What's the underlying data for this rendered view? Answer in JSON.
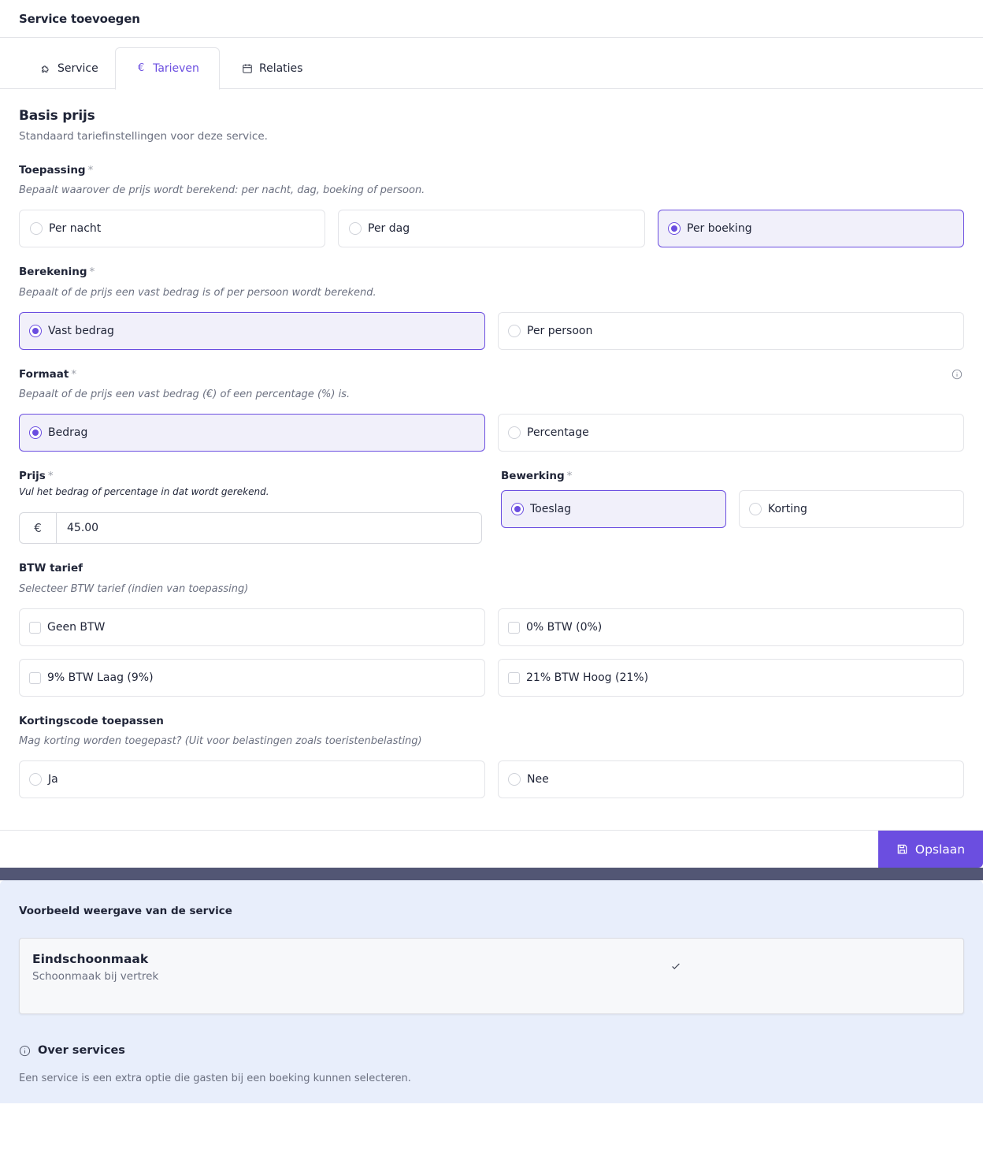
{
  "header": {
    "title": "Service toevoegen"
  },
  "tabs": [
    {
      "label": "Service",
      "icon": "puzzle-icon"
    },
    {
      "label": "Tarieven",
      "icon": "euro-icon"
    },
    {
      "label": "Relaties",
      "icon": "calendar-icon"
    }
  ],
  "active_tab": "Tarieven",
  "basis": {
    "title": "Basis prijs",
    "subtitle": "Standaard tariefinstellingen voor deze service."
  },
  "toepassing": {
    "label": "Toepassing",
    "required": "*",
    "hint": "Bepaalt waarover de prijs wordt berekend: per nacht, dag, boeking of persoon.",
    "options": [
      "Per nacht",
      "Per dag",
      "Per boeking"
    ],
    "selected": "Per boeking"
  },
  "berekening": {
    "label": "Berekening",
    "required": "*",
    "hint": "Bepaalt of de prijs een vast bedrag is of per persoon wordt berekend.",
    "options": [
      "Vast bedrag",
      "Per persoon"
    ],
    "selected": "Vast bedrag"
  },
  "formaat": {
    "label": "Formaat",
    "required": "*",
    "hint": "Bepaalt of de prijs een vast bedrag (€) of een percentage (%) is.",
    "options": [
      "Bedrag",
      "Percentage"
    ],
    "selected": "Bedrag"
  },
  "prijs": {
    "label": "Prijs",
    "required": "*",
    "hint": "Vul het bedrag of percentage in dat wordt gerekend.",
    "prefix": "€",
    "value": "45.00"
  },
  "bewerking": {
    "label": "Bewerking",
    "required": "*",
    "options": [
      "Toeslag",
      "Korting"
    ],
    "selected": "Toeslag"
  },
  "btw": {
    "label": "BTW tarief",
    "hint": "Selecteer BTW tarief (indien van toepassing)",
    "options": [
      "Geen BTW",
      "0% BTW (0%)",
      "9% BTW Laag (9%)",
      "21% BTW Hoog (21%)"
    ]
  },
  "korting": {
    "label": "Kortingscode toepassen",
    "hint": "Mag korting worden toegepast? (Uit voor belastingen zoals toeristenbelasting)",
    "options": [
      "Ja",
      "Nee"
    ]
  },
  "save_label": "Opslaan",
  "preview": {
    "title": "Voorbeeld weergave van de service",
    "service_name": "Eindschoonmaak",
    "service_desc": "Schoonmaak bij vertrek",
    "about_title": "Over services",
    "about_text": "Een service is een extra optie die gasten bij een boeking kunnen selecteren."
  },
  "colors": {
    "accent": "#6b4ee0",
    "selected_bg": "#f1f0fa",
    "band": "#525674",
    "preview_bg": "#e8eefb"
  }
}
